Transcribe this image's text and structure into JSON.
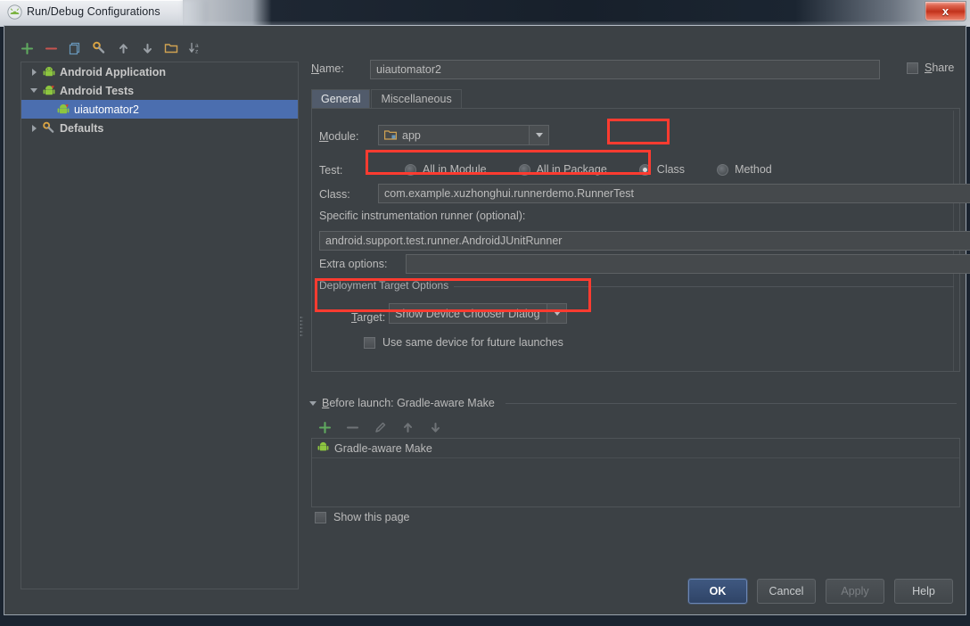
{
  "window": {
    "title": "Run/Debug Configurations",
    "title_icon": "android-studio-icon",
    "close_label": "x"
  },
  "left_panel": {
    "toolbar": [
      {
        "name": "add-button",
        "glyph": "+",
        "color": "#5fa85f"
      },
      {
        "name": "remove-button",
        "glyph": "−",
        "color": "#c75450"
      },
      {
        "name": "copy-configuration-button",
        "glyph": "copy-icon",
        "color": "#6897bb"
      },
      {
        "name": "edit-defaults-button",
        "glyph": "wrench-icon",
        "color": "#d9a343"
      },
      {
        "name": "move-up-button",
        "glyph": "↑",
        "color": "#9aa0a6"
      },
      {
        "name": "move-down-button",
        "glyph": "↓",
        "color": "#9aa0a6"
      },
      {
        "name": "new-folder-button",
        "glyph": "folder-icon",
        "color": "#d0a252"
      },
      {
        "name": "sort-alphabetically-button",
        "glyph": "sort-az-icon",
        "color": "#9aa0a6"
      }
    ],
    "tree": [
      {
        "label": "Android Application",
        "icon": "android-icon",
        "expanded": false,
        "depth": 0,
        "selected": false,
        "bold": true
      },
      {
        "label": "Android Tests",
        "icon": "android-test-icon",
        "expanded": true,
        "depth": 0,
        "selected": false,
        "bold": true
      },
      {
        "label": "uiautomator2",
        "icon": "android-test-icon",
        "expanded": null,
        "depth": 1,
        "selected": true,
        "bold": false
      },
      {
        "label": "Defaults",
        "icon": "wrench-icon",
        "expanded": false,
        "depth": 0,
        "selected": false,
        "bold": true
      }
    ]
  },
  "right_panel": {
    "name_label": "Name:",
    "name_value": "uiautomator2",
    "share_label": "Share",
    "share_checked": false,
    "tabs": [
      {
        "label": "General",
        "active": true
      },
      {
        "label": "Miscellaneous",
        "active": false
      }
    ],
    "module_label": "Module:",
    "module_value": "app",
    "module_icon": "module-folder-icon",
    "test_label": "Test:",
    "test_options": [
      {
        "label": "All in Module",
        "checked": false
      },
      {
        "label": "All in Package",
        "checked": false
      },
      {
        "label": "Class",
        "checked": true
      },
      {
        "label": "Method",
        "checked": false
      }
    ],
    "class_label": "Class:",
    "class_value": "com.example.xuzhonghui.runnerdemo.RunnerTest",
    "class_browse_label": "...",
    "runner_label": "Specific instrumentation runner (optional):",
    "runner_value": "android.support.test.runner.AndroidJUnitRunner",
    "runner_browse_label": "...",
    "extra_options_label": "Extra options:",
    "extra_options_value": "",
    "deployment_group_title": "Deployment Target Options",
    "target_label": "Target:",
    "target_value": "Show Device Chooser Dialog",
    "use_same_device_label": "Use same device for future launches",
    "use_same_device_checked": false,
    "before_launch_title": "Before launch: Gradle-aware Make",
    "before_launch_toolbar": [
      {
        "name": "add-task-button",
        "glyph": "+",
        "color": "#5fa85f"
      },
      {
        "name": "remove-task-button",
        "glyph": "−",
        "color": "#7b7f83"
      },
      {
        "name": "edit-task-button",
        "glyph": "pencil-icon",
        "color": "#7b7f83"
      },
      {
        "name": "move-task-up-button",
        "glyph": "↑",
        "color": "#7b7f83"
      },
      {
        "name": "move-task-down-button",
        "glyph": "↓",
        "color": "#7b7f83"
      }
    ],
    "before_launch_items": [
      {
        "label": "Gradle-aware Make",
        "icon": "android-icon"
      }
    ],
    "show_this_page_label": "Show this page",
    "show_this_page_checked": false
  },
  "buttons": [
    {
      "label": "OK",
      "style": "default"
    },
    {
      "label": "Cancel",
      "style": "normal"
    },
    {
      "label": "Apply",
      "style": "disabled"
    },
    {
      "label": "Help",
      "style": "normal"
    }
  ],
  "annotations": {
    "color": "#ff3b30",
    "regions": [
      "class-radio-option",
      "class-input-field",
      "deployment-target-combo"
    ]
  }
}
